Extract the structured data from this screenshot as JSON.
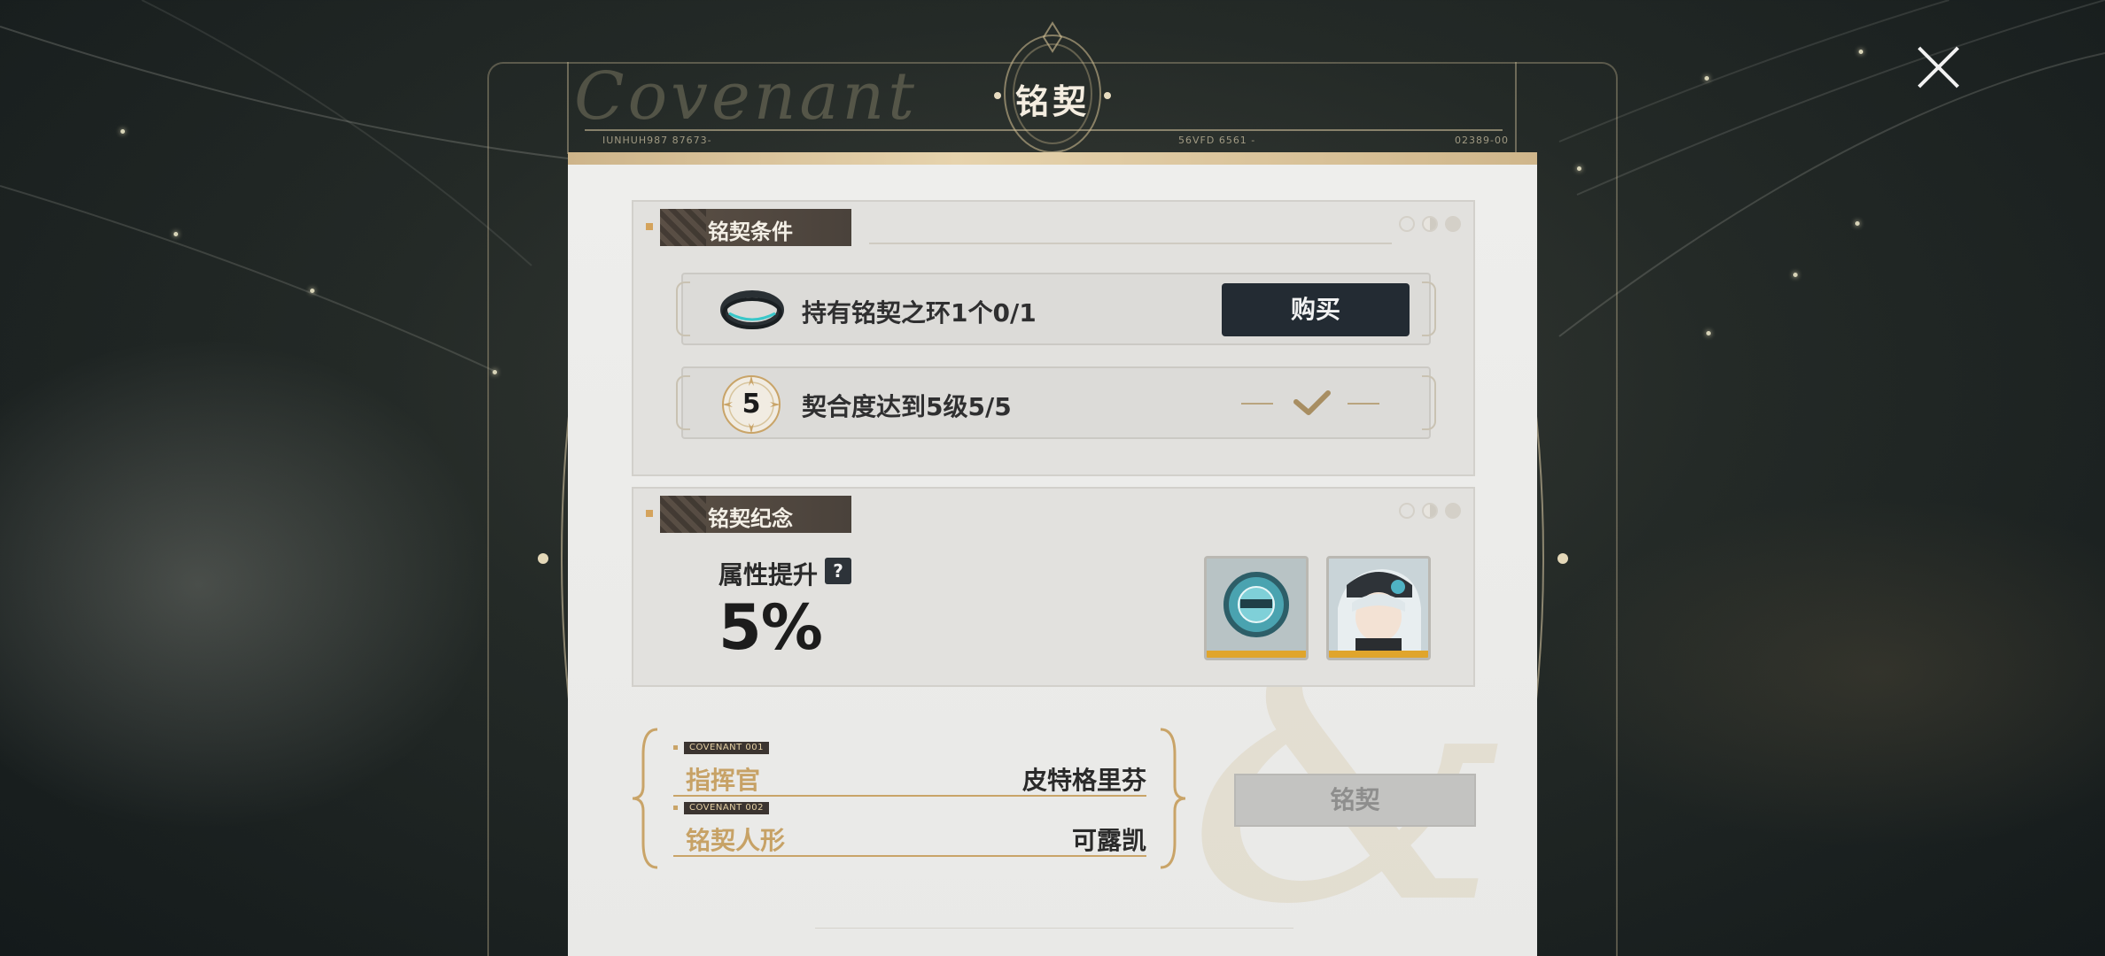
{
  "header": {
    "title": "铭契",
    "script_word": "Covenant",
    "codes": [
      "IUNHUH987 87673-",
      "56VFD 6561 -",
      "02389-00"
    ]
  },
  "conditions": {
    "title": "铭契条件",
    "items": [
      {
        "icon": "ring-icon",
        "text": "持有铭契之环1个0/1",
        "action_label": "购买"
      },
      {
        "icon": "level-badge-icon",
        "level": "5",
        "text": "契合度达到5级5/5",
        "status": "check-icon"
      }
    ]
  },
  "memorial": {
    "title": "铭契纪念",
    "attr_label": "属性提升",
    "help": "?",
    "attr_value": "5%",
    "rewards": [
      {
        "name": "covenant-badge-icon"
      },
      {
        "name": "character-portrait"
      }
    ]
  },
  "names": [
    {
      "tag": "COVENANT  001",
      "role": "指挥官",
      "who": "皮特格里芬"
    },
    {
      "tag": "COVENANT  002",
      "role": "铭契人形",
      "who": "可露凯"
    }
  ],
  "covenant_button": "铭契",
  "colors": {
    "accent_gold": "#c7a266",
    "dark_button": "#232b33",
    "reward_bar": "#e0a52c"
  }
}
